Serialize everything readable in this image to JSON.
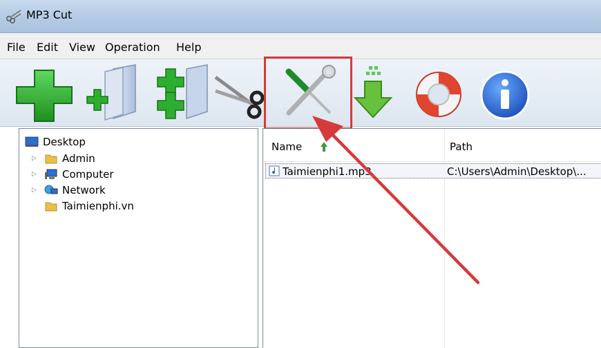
{
  "window": {
    "title": "MP3 Cut",
    "icon": "scissors-icon"
  },
  "menu": {
    "items": [
      "File",
      "Edit",
      "View",
      "Operation",
      "Help"
    ]
  },
  "toolbar": {
    "buttons": [
      {
        "name": "add-button",
        "icon": "green-plus-icon"
      },
      {
        "name": "add-folder-button",
        "icon": "folder-plus-icon"
      },
      {
        "name": "add-multiple-button",
        "icon": "stacked-plus-icon"
      },
      {
        "name": "cut-button",
        "icon": "scissors-icon"
      },
      {
        "name": "options-button",
        "icon": "screwdriver-wrench-icon"
      },
      {
        "name": "download-button",
        "icon": "green-down-arrow-icon"
      },
      {
        "name": "help-button",
        "icon": "lifebuoy-icon"
      },
      {
        "name": "about-button",
        "icon": "info-icon"
      }
    ]
  },
  "tree": {
    "root": "Desktop",
    "items": [
      {
        "label": "Admin",
        "icon": "folder-icon",
        "expandable": true
      },
      {
        "label": "Computer",
        "icon": "computer-icon",
        "expandable": true
      },
      {
        "label": "Network",
        "icon": "network-icon",
        "expandable": true
      },
      {
        "label": "Taimienphi.vn",
        "icon": "folder-icon",
        "expandable": false
      }
    ]
  },
  "file_list": {
    "columns": [
      "Name",
      "Path"
    ],
    "rows": [
      {
        "name": "Taimienphi1.mp3",
        "path": "C:\\Users\\Admin\\Desktop\\..."
      }
    ]
  },
  "annotation": {
    "color": "#d63a3a",
    "target": "options-button"
  }
}
